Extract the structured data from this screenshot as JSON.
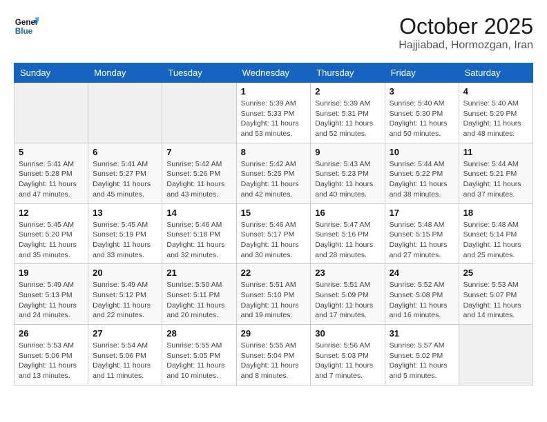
{
  "header": {
    "logo_line1": "General",
    "logo_line2": "Blue",
    "month": "October 2025",
    "location": "Hajjiabad, Hormozgan, Iran"
  },
  "days_of_week": [
    "Sunday",
    "Monday",
    "Tuesday",
    "Wednesday",
    "Thursday",
    "Friday",
    "Saturday"
  ],
  "weeks": [
    [
      {
        "day": "",
        "info": ""
      },
      {
        "day": "",
        "info": ""
      },
      {
        "day": "",
        "info": ""
      },
      {
        "day": "1",
        "info": "Sunrise: 5:39 AM\nSunset: 5:33 PM\nDaylight: 11 hours and 53 minutes."
      },
      {
        "day": "2",
        "info": "Sunrise: 5:39 AM\nSunset: 5:31 PM\nDaylight: 11 hours and 52 minutes."
      },
      {
        "day": "3",
        "info": "Sunrise: 5:40 AM\nSunset: 5:30 PM\nDaylight: 11 hours and 50 minutes."
      },
      {
        "day": "4",
        "info": "Sunrise: 5:40 AM\nSunset: 5:29 PM\nDaylight: 11 hours and 48 minutes."
      }
    ],
    [
      {
        "day": "5",
        "info": "Sunrise: 5:41 AM\nSunset: 5:28 PM\nDaylight: 11 hours and 47 minutes."
      },
      {
        "day": "6",
        "info": "Sunrise: 5:41 AM\nSunset: 5:27 PM\nDaylight: 11 hours and 45 minutes."
      },
      {
        "day": "7",
        "info": "Sunrise: 5:42 AM\nSunset: 5:26 PM\nDaylight: 11 hours and 43 minutes."
      },
      {
        "day": "8",
        "info": "Sunrise: 5:42 AM\nSunset: 5:25 PM\nDaylight: 11 hours and 42 minutes."
      },
      {
        "day": "9",
        "info": "Sunrise: 5:43 AM\nSunset: 5:23 PM\nDaylight: 11 hours and 40 minutes."
      },
      {
        "day": "10",
        "info": "Sunrise: 5:44 AM\nSunset: 5:22 PM\nDaylight: 11 hours and 38 minutes."
      },
      {
        "day": "11",
        "info": "Sunrise: 5:44 AM\nSunset: 5:21 PM\nDaylight: 11 hours and 37 minutes."
      }
    ],
    [
      {
        "day": "12",
        "info": "Sunrise: 5:45 AM\nSunset: 5:20 PM\nDaylight: 11 hours and 35 minutes."
      },
      {
        "day": "13",
        "info": "Sunrise: 5:45 AM\nSunset: 5:19 PM\nDaylight: 11 hours and 33 minutes."
      },
      {
        "day": "14",
        "info": "Sunrise: 5:46 AM\nSunset: 5:18 PM\nDaylight: 11 hours and 32 minutes."
      },
      {
        "day": "15",
        "info": "Sunrise: 5:46 AM\nSunset: 5:17 PM\nDaylight: 11 hours and 30 minutes."
      },
      {
        "day": "16",
        "info": "Sunrise: 5:47 AM\nSunset: 5:16 PM\nDaylight: 11 hours and 28 minutes."
      },
      {
        "day": "17",
        "info": "Sunrise: 5:48 AM\nSunset: 5:15 PM\nDaylight: 11 hours and 27 minutes."
      },
      {
        "day": "18",
        "info": "Sunrise: 5:48 AM\nSunset: 5:14 PM\nDaylight: 11 hours and 25 minutes."
      }
    ],
    [
      {
        "day": "19",
        "info": "Sunrise: 5:49 AM\nSunset: 5:13 PM\nDaylight: 11 hours and 24 minutes."
      },
      {
        "day": "20",
        "info": "Sunrise: 5:49 AM\nSunset: 5:12 PM\nDaylight: 11 hours and 22 minutes."
      },
      {
        "day": "21",
        "info": "Sunrise: 5:50 AM\nSunset: 5:11 PM\nDaylight: 11 hours and 20 minutes."
      },
      {
        "day": "22",
        "info": "Sunrise: 5:51 AM\nSunset: 5:10 PM\nDaylight: 11 hours and 19 minutes."
      },
      {
        "day": "23",
        "info": "Sunrise: 5:51 AM\nSunset: 5:09 PM\nDaylight: 11 hours and 17 minutes."
      },
      {
        "day": "24",
        "info": "Sunrise: 5:52 AM\nSunset: 5:08 PM\nDaylight: 11 hours and 16 minutes."
      },
      {
        "day": "25",
        "info": "Sunrise: 5:53 AM\nSunset: 5:07 PM\nDaylight: 11 hours and 14 minutes."
      }
    ],
    [
      {
        "day": "26",
        "info": "Sunrise: 5:53 AM\nSunset: 5:06 PM\nDaylight: 11 hours and 13 minutes."
      },
      {
        "day": "27",
        "info": "Sunrise: 5:54 AM\nSunset: 5:06 PM\nDaylight: 11 hours and 11 minutes."
      },
      {
        "day": "28",
        "info": "Sunrise: 5:55 AM\nSunset: 5:05 PM\nDaylight: 11 hours and 10 minutes."
      },
      {
        "day": "29",
        "info": "Sunrise: 5:55 AM\nSunset: 5:04 PM\nDaylight: 11 hours and 8 minutes."
      },
      {
        "day": "30",
        "info": "Sunrise: 5:56 AM\nSunset: 5:03 PM\nDaylight: 11 hours and 7 minutes."
      },
      {
        "day": "31",
        "info": "Sunrise: 5:57 AM\nSunset: 5:02 PM\nDaylight: 11 hours and 5 minutes."
      },
      {
        "day": "",
        "info": ""
      }
    ]
  ]
}
